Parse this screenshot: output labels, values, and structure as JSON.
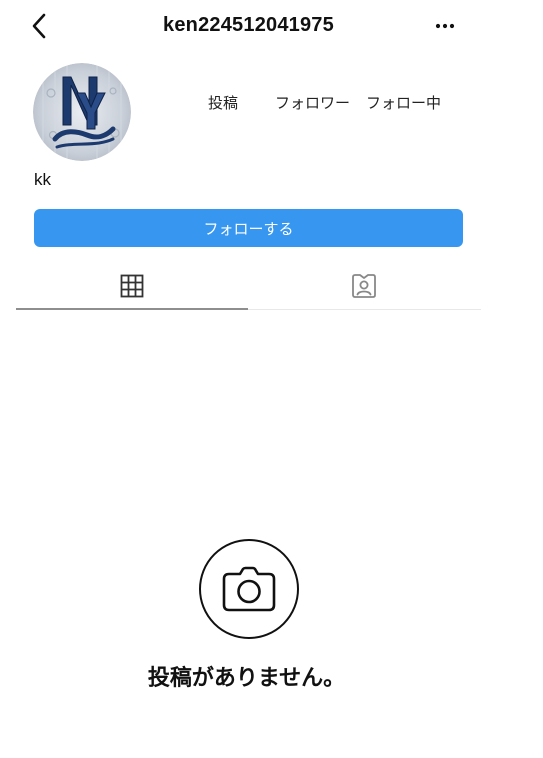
{
  "header": {
    "username": "ken224512041975",
    "back_icon": "chevron-left-icon",
    "more_icon": "more-horizontal-icon"
  },
  "profile": {
    "avatar_alt": "NY Yankees logo",
    "display_name": "kk",
    "stats": {
      "posts_label": "投稿",
      "followers_label": "フォロワー",
      "following_label": "フォロー中"
    },
    "follow_button_label": "フォローする"
  },
  "tabs": [
    {
      "id": "grid",
      "icon": "grid-icon",
      "active": true
    },
    {
      "id": "tagged",
      "icon": "tagged-person-icon",
      "active": false
    }
  ],
  "empty_state": {
    "icon": "camera-icon",
    "message": "投稿がありません。"
  },
  "colors": {
    "accent": "#3797f0",
    "text": "#111111",
    "muted": "#8e8e8e"
  }
}
